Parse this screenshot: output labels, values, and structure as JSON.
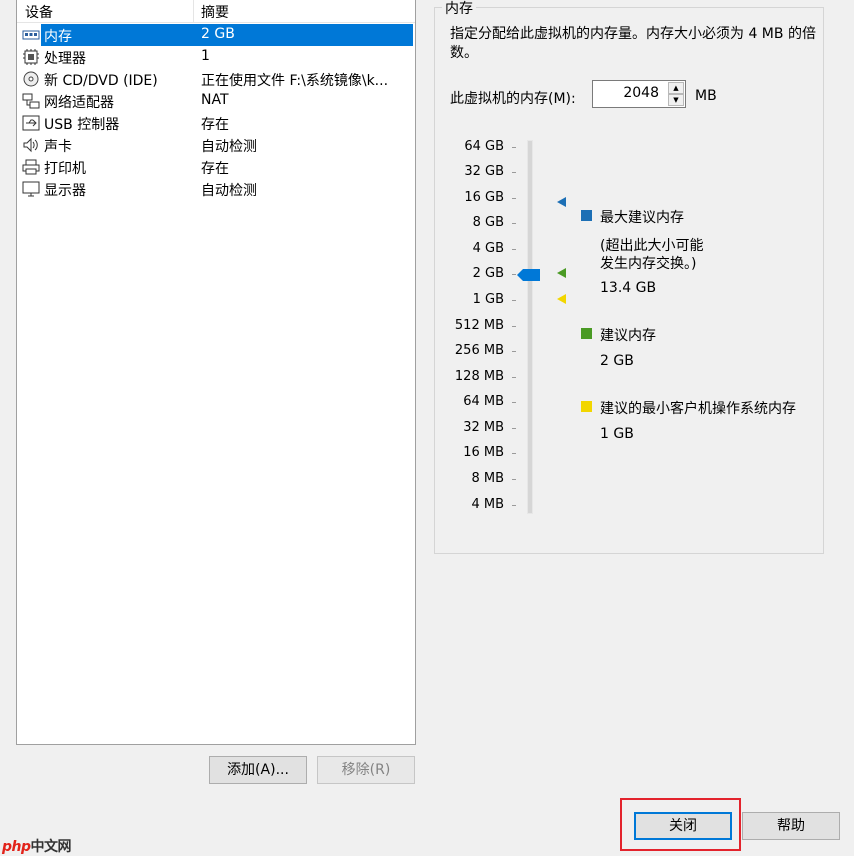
{
  "device_list": {
    "headers": {
      "device": "设备",
      "summary": "摘要"
    },
    "rows": [
      {
        "name": "内存",
        "summary": "2 GB",
        "icon": "memory-icon"
      },
      {
        "name": "处理器",
        "summary": "1",
        "icon": "cpu-icon"
      },
      {
        "name": "新 CD/DVD (IDE)",
        "summary": "正在使用文件 F:\\系统镜像\\k...",
        "icon": "cd-icon"
      },
      {
        "name": "网络适配器",
        "summary": "NAT",
        "icon": "network-icon"
      },
      {
        "name": "USB 控制器",
        "summary": "存在",
        "icon": "usb-icon"
      },
      {
        "name": "声卡",
        "summary": "自动检测",
        "icon": "speaker-icon"
      },
      {
        "name": "打印机",
        "summary": "存在",
        "icon": "printer-icon"
      },
      {
        "name": "显示器",
        "summary": "自动检测",
        "icon": "monitor-icon"
      }
    ],
    "add_button": "添加(A)...",
    "remove_button": "移除(R)"
  },
  "memory": {
    "group_title": "内存",
    "description": "指定分配给此虚拟机的内存量。内存大小必须为 4 MB 的倍数。",
    "input_label": "此虚拟机的内存(M):",
    "value": "2048",
    "unit": "MB",
    "scale_labels": [
      "64 GB",
      "32 GB",
      "16 GB",
      "8 GB",
      "4 GB",
      "2 GB",
      "1 GB",
      "512 MB",
      "256 MB",
      "128 MB",
      "64 MB",
      "32 MB",
      "16 MB",
      "8 MB",
      "4 MB"
    ],
    "legend": {
      "max": {
        "title": "最大建议内存",
        "note_line1": "(超出此大小可能",
        "note_line2": "发生内存交换。)",
        "value": "13.4 GB",
        "color": "#1c6fb5"
      },
      "recommended": {
        "title": "建议内存",
        "value": "2 GB",
        "color": "#4a9a24"
      },
      "minimum": {
        "title": "建议的最小客户机操作系统内存",
        "value": "1 GB",
        "color": "#f2d600"
      }
    },
    "slider_color": "#0078d7"
  },
  "footer": {
    "close_button": "关闭",
    "help_button": "帮助"
  },
  "watermark": {
    "brand": "php",
    "site": "中文网"
  }
}
